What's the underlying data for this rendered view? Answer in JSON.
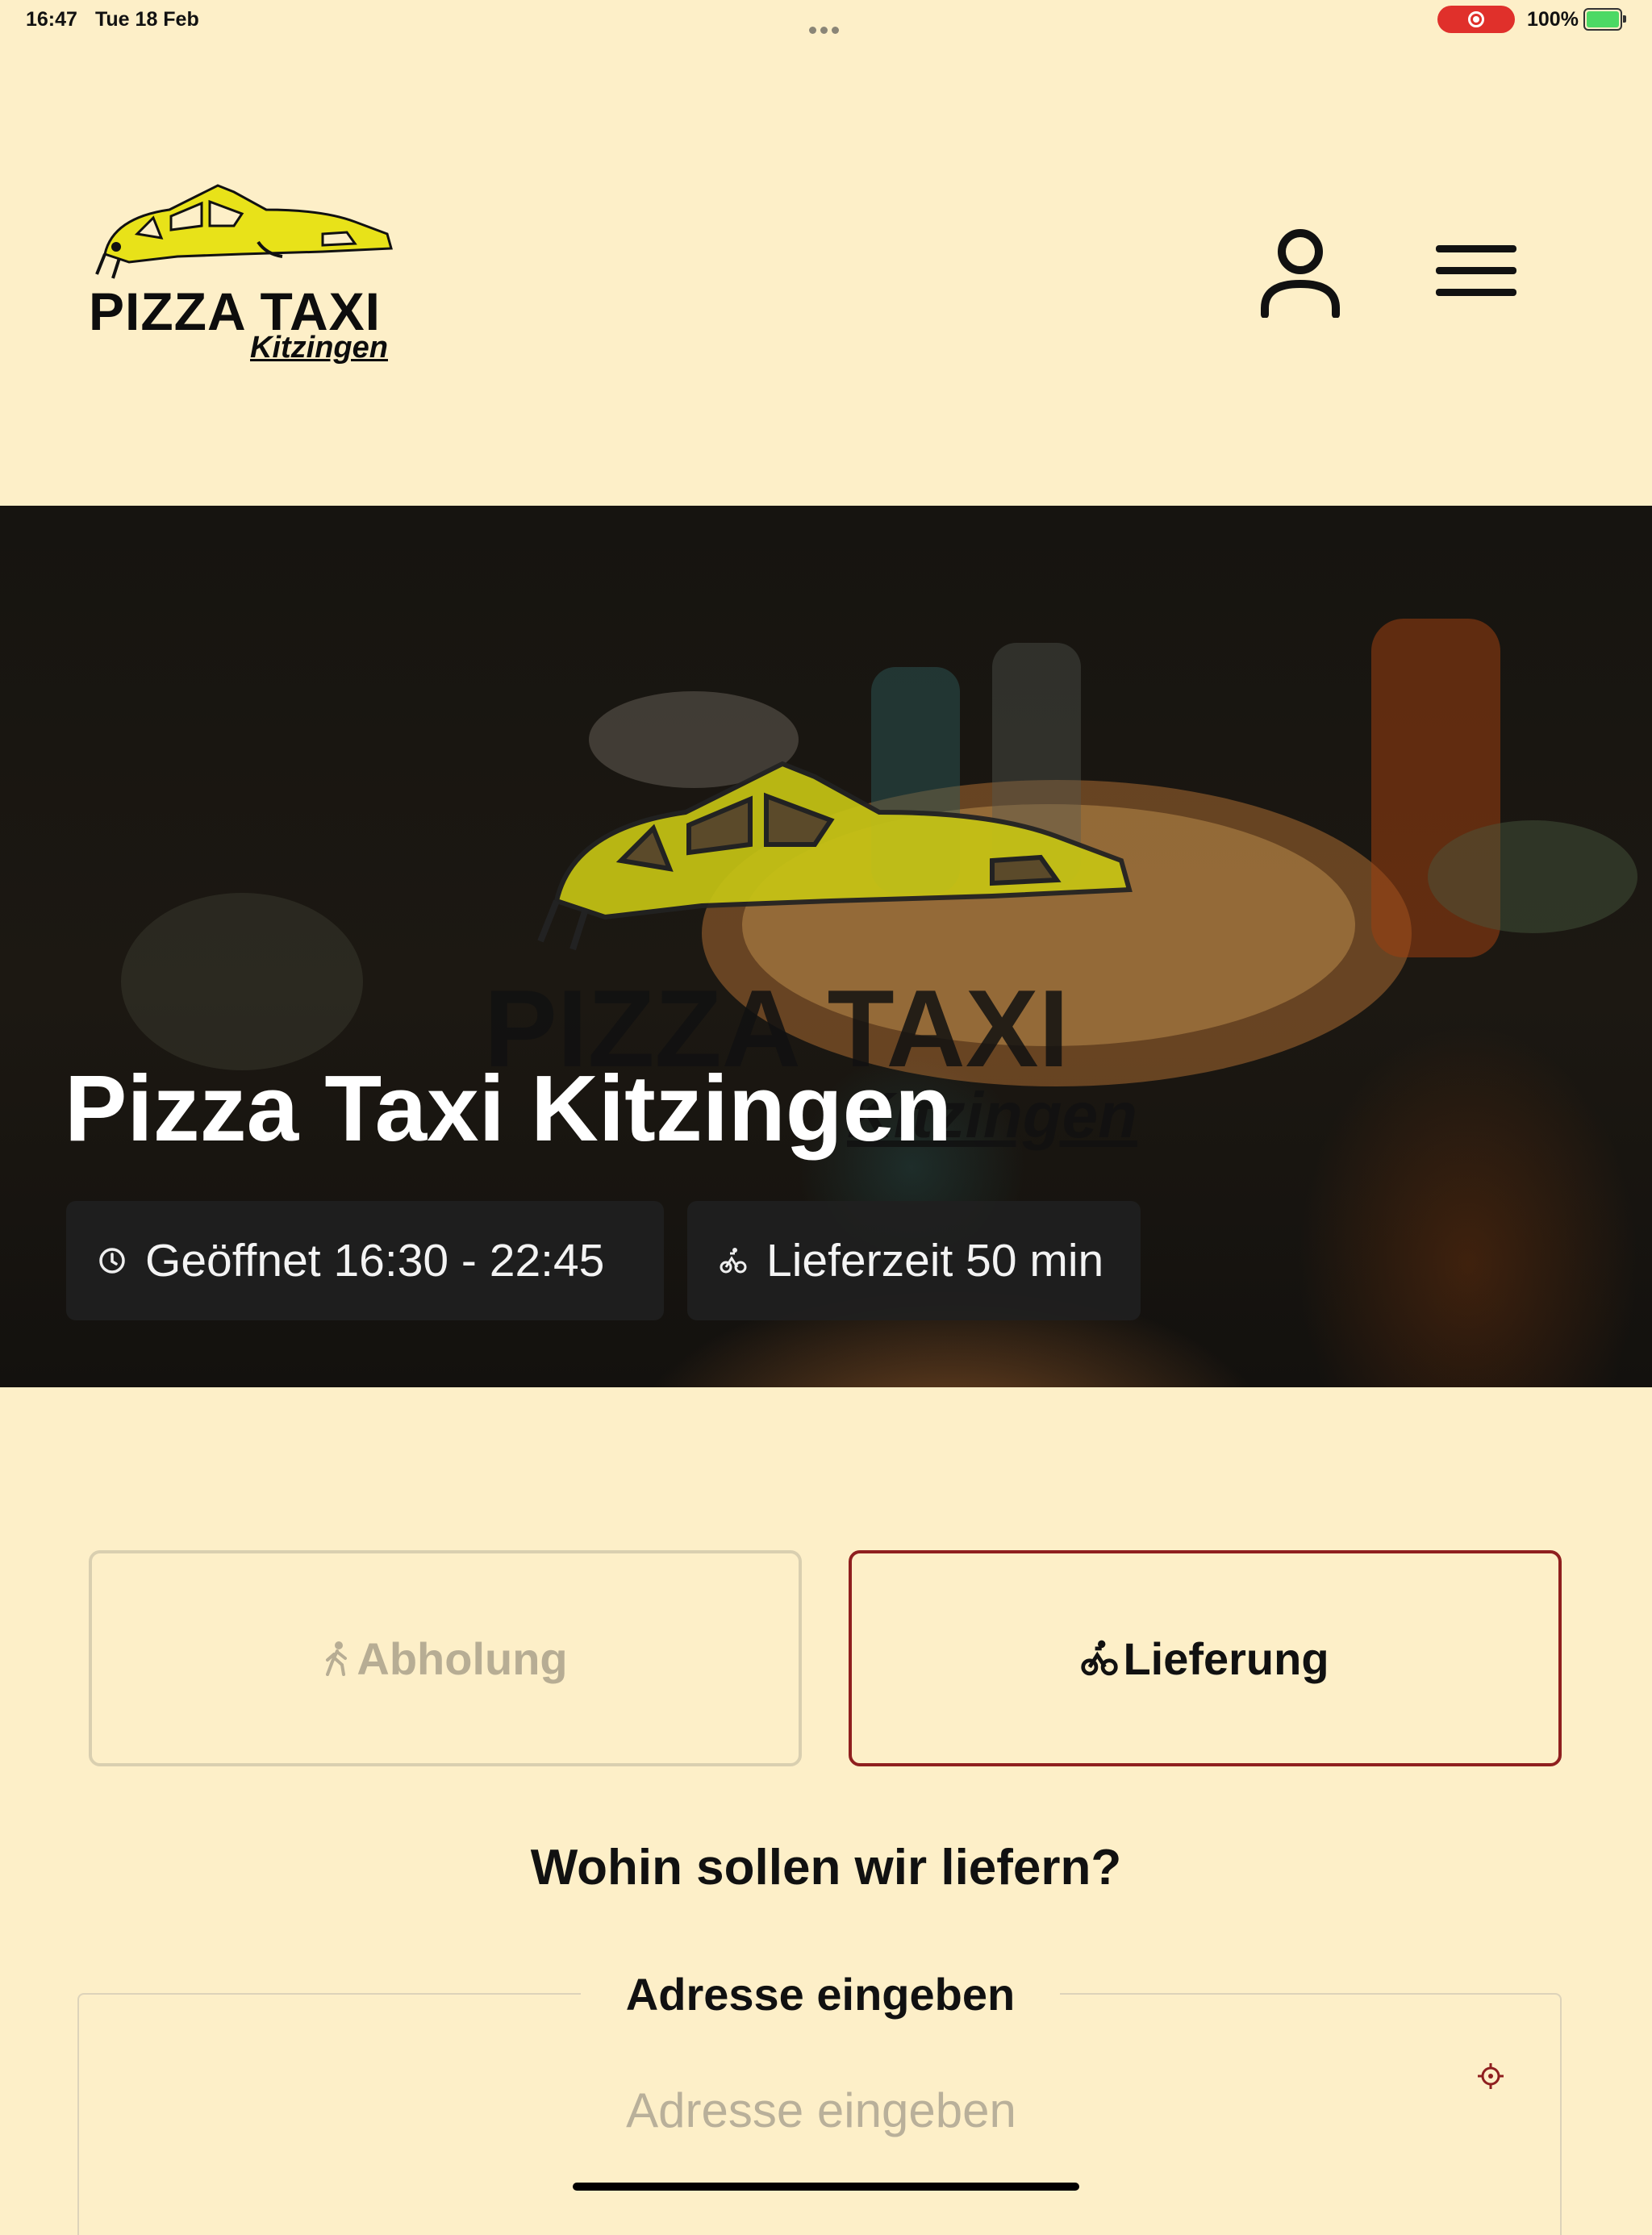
{
  "status_bar": {
    "time": "16:47",
    "date": "Tue 18 Feb",
    "battery": "100%"
  },
  "header": {
    "logo_title": "PIZZA TAXI",
    "logo_subtitle": "Kitzingen",
    "account_icon": "user-icon",
    "menu_icon": "hamburger-menu-icon"
  },
  "hero": {
    "watermark_title": "PIZZA TAXI",
    "watermark_subtitle": "Kitzingen",
    "title": "Pizza Taxi Kitzingen",
    "opening_hours": "Geöffnet 16:30 - 22:45",
    "delivery_time": "Lieferzeit 50 min"
  },
  "order_mode": {
    "pickup_label": "Abholung",
    "delivery_label": "Lieferung",
    "selected": "delivery"
  },
  "address": {
    "question": "Wohin sollen wir liefern?",
    "legend": "Adresse eingeben",
    "placeholder": "Adresse eingeben",
    "locate_icon": "crosshair-locate-icon"
  },
  "colors": {
    "background": "#fdefc8",
    "accent": "#8f1f1f",
    "logo_yellow": "#e8e219"
  }
}
